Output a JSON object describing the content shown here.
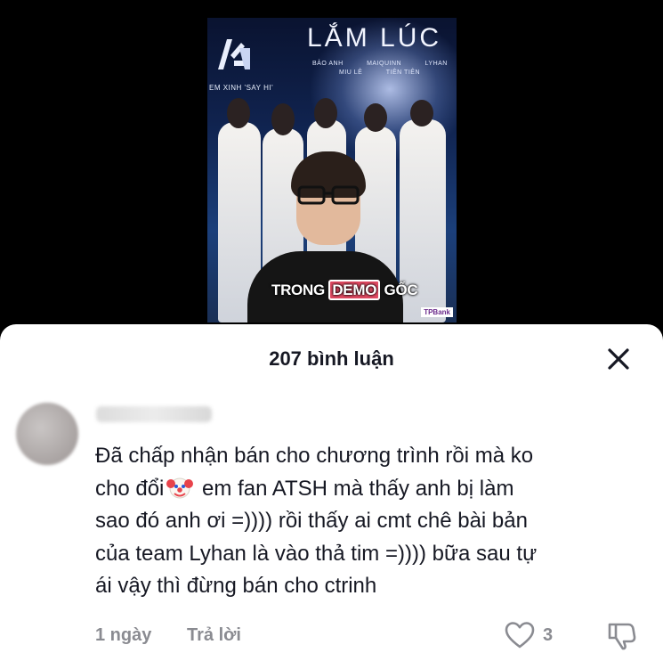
{
  "video": {
    "poster_title": "LẮM LÚC",
    "poster_tagline": "EM XINH 'SAY HI'",
    "poster_names_row1": [
      "BẢO ANH",
      "MAIQUINN",
      "LYHAN"
    ],
    "poster_names_row2": [
      "MIU LÊ",
      "TIÊN TIÊN"
    ],
    "caption_before": "TRONG ",
    "caption_highlight": "DEMO",
    "caption_after": " GỐC",
    "bank_logo": "TPBank"
  },
  "comments_sheet": {
    "title": "207 bình luận",
    "close_icon": "close-icon",
    "comment": {
      "lines": [
        "Đã chấp nhận bán cho chương trình rồi mà ko",
        [
          "cho đổi",
          " em fan ATSH mà thấy anh bị làm"
        ],
        "sao đó anh ơi =)))) rồi thấy ai cmt chê bài bản",
        "của team Lyhan là vào thả tim =)))) bữa sau tự",
        "ái vậy thì đừng bán cho ctrinh"
      ],
      "emoji": "clown-face-icon",
      "time": "1 ngày",
      "reply_label": "Trả lời",
      "like_count": "3"
    }
  },
  "colors": {
    "text_primary": "#161823",
    "text_secondary": "#8a8b91",
    "caption_highlight": "#e04a62"
  }
}
